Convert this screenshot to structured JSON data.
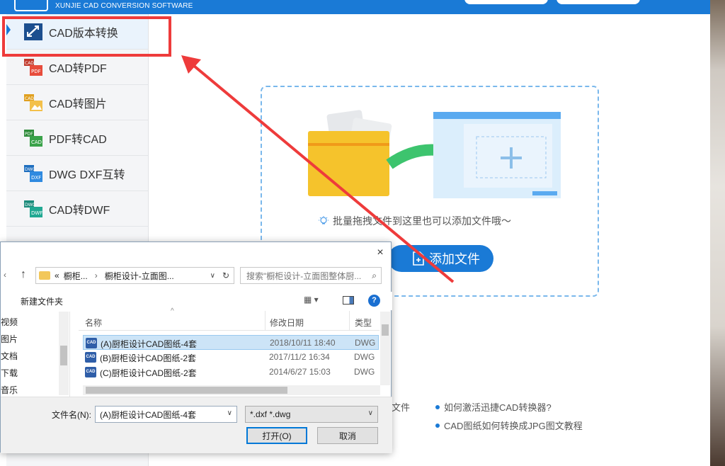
{
  "app": {
    "brand_subtitle": "XUNJIE CAD CONVERSION SOFTWARE",
    "accent": "#1a7ad6"
  },
  "sidebar": {
    "items": [
      {
        "label": "CAD版本转换",
        "icon": "cad-version-icon",
        "active": true
      },
      {
        "label": "CAD转PDF",
        "icon": "cad-to-pdf-icon"
      },
      {
        "label": "CAD转图片",
        "icon": "cad-to-image-icon"
      },
      {
        "label": "PDF转CAD",
        "icon": "pdf-to-cad-icon"
      },
      {
        "label": "DWG DXF互转",
        "icon": "dwg-dxf-icon"
      },
      {
        "label": "CAD转DWF",
        "icon": "cad-to-dwf-icon"
      }
    ]
  },
  "main": {
    "drop_hint": "批量拖拽文件到这里也可以添加文件哦～",
    "add_button": "添加文件",
    "help_links": [
      "文件",
      "如何激活迅捷CAD转换器?",
      "CAD图纸如何转换成JPG图文教程"
    ]
  },
  "dialog": {
    "close": "×",
    "path_prefix": "«",
    "path_parts": [
      "橱柜...",
      "橱柜设计-立面图..."
    ],
    "search_placeholder": "搜索\"橱柜设计-立面图整体厨...",
    "new_folder": "新建文件夹",
    "left_items": [
      "视频",
      "图片",
      "文档",
      "下载",
      "音乐"
    ],
    "columns": {
      "name": "名称",
      "date": "修改日期",
      "type": "类型"
    },
    "files": [
      {
        "icon": "CAD",
        "name": "(A)厨柜设计CAD图纸-4套",
        "date": "2018/10/11 18:40",
        "type": "DWG",
        "selected": true
      },
      {
        "icon": "CAD",
        "name": "(B)厨柜设计CAD图纸-2套",
        "date": "2017/11/2 16:34",
        "type": "DWG"
      },
      {
        "icon": "CAD",
        "name": "(C)厨柜设计CAD图纸-2套",
        "date": "2014/6/27 15:03",
        "type": "DWG"
      }
    ],
    "filename_label": "文件名(N):",
    "filename_value": "(A)厨柜设计CAD图纸-4套",
    "filetype_value": "*.dxf *.dwg",
    "open_button": "打开(O)",
    "cancel_button": "取消"
  }
}
